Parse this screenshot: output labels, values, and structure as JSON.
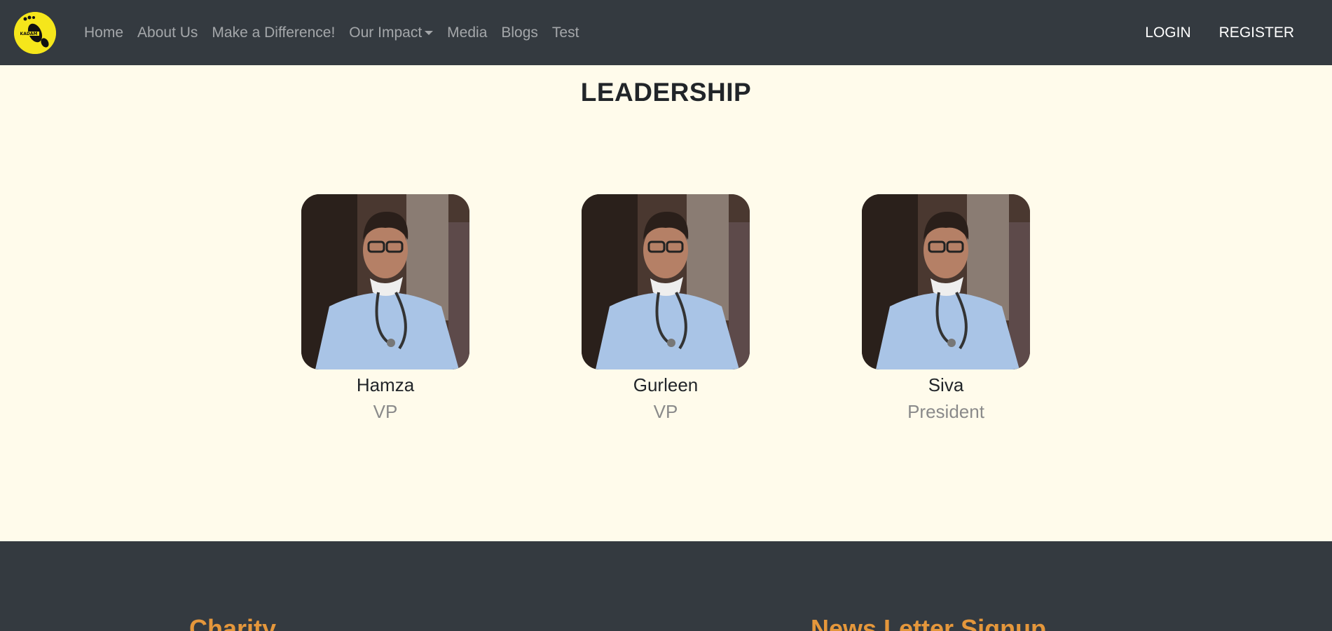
{
  "navbar": {
    "logo_icon": "footprint-logo-icon",
    "brand_text": "KADAM",
    "links": [
      {
        "label": "Home"
      },
      {
        "label": "About Us"
      },
      {
        "label": "Make a Difference!"
      },
      {
        "label": "Our Impact",
        "dropdown": true
      },
      {
        "label": "Media"
      },
      {
        "label": "Blogs"
      },
      {
        "label": "Test"
      }
    ],
    "login_label": "LOGIN",
    "register_label": "REGISTER"
  },
  "leadership": {
    "title": "LEADERSHIP",
    "members": [
      {
        "name": "Hamza",
        "role": "VP"
      },
      {
        "name": "Gurleen",
        "role": "VP"
      },
      {
        "name": "Siva",
        "role": "President"
      }
    ]
  },
  "footer": {
    "charity_heading": "Charity",
    "newsletter_heading": "News Letter Signup"
  },
  "colors": {
    "navbar_bg": "#343a40",
    "page_bg": "#fffbeb",
    "logo_yellow": "#f5e61b",
    "footer_heading": "#e5973b"
  }
}
